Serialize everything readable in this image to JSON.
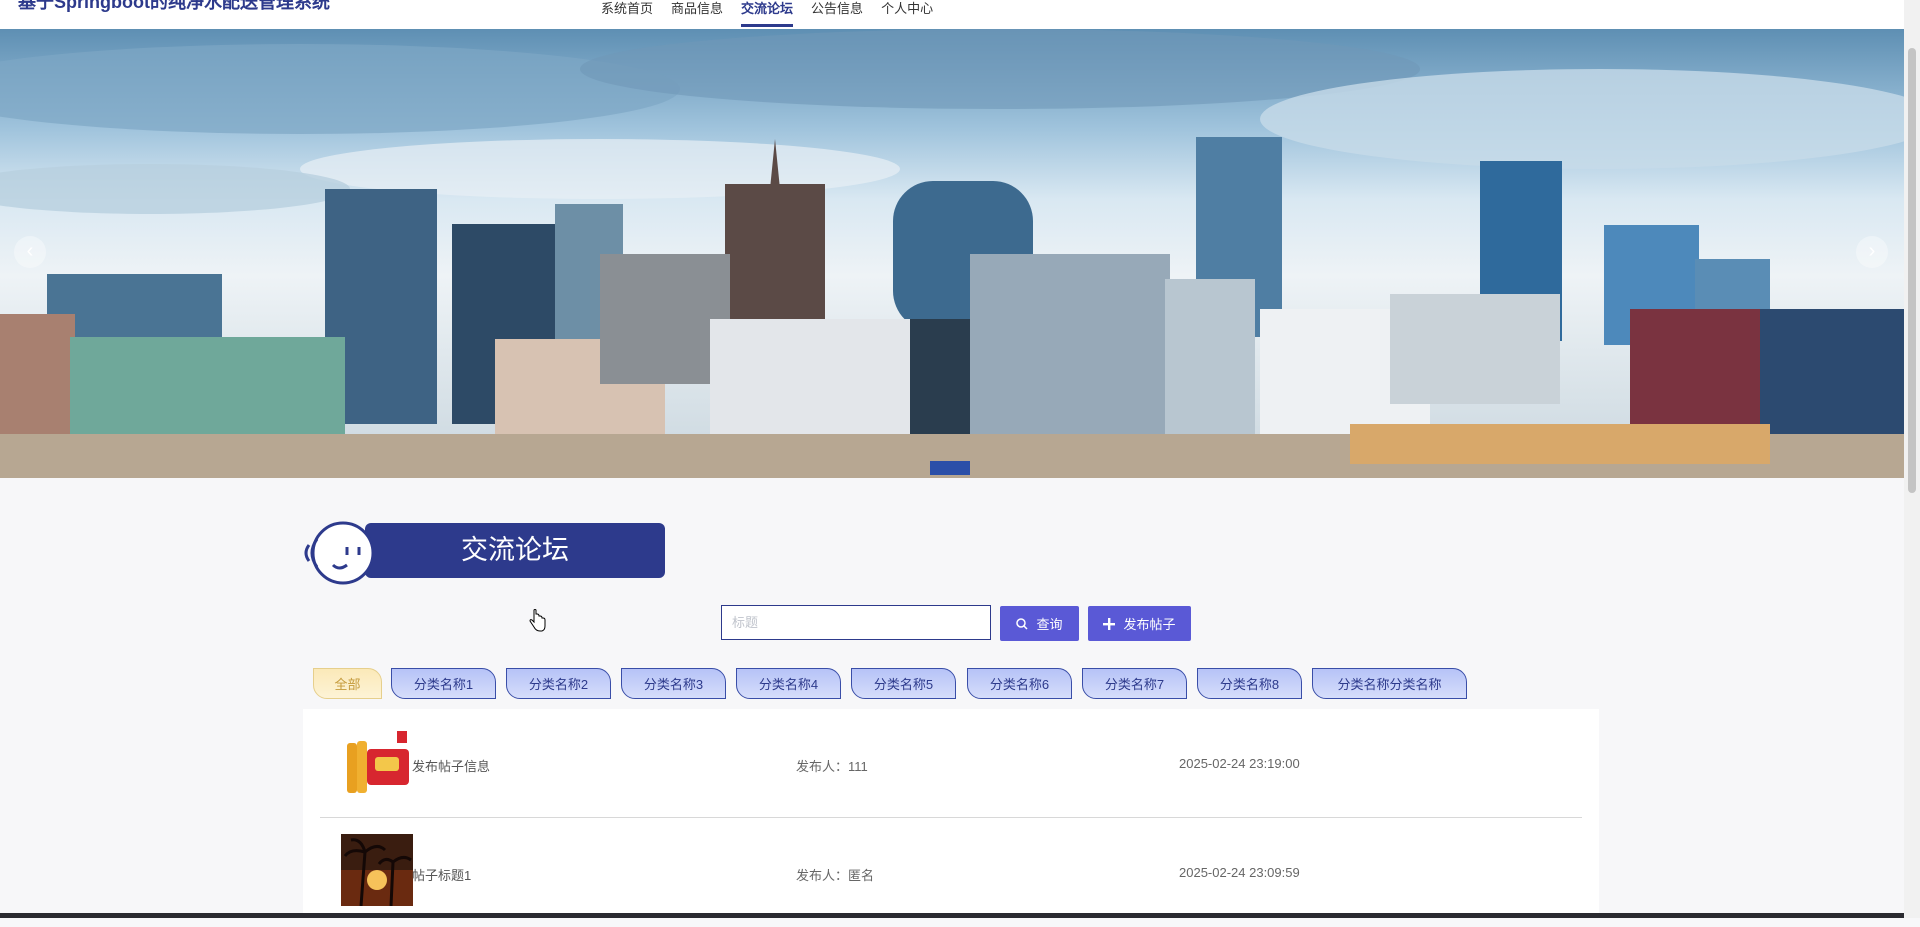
{
  "header": {
    "site_title": "基于Springboot的纯净水配送管理系统",
    "nav": [
      {
        "label": "系统首页",
        "active": false
      },
      {
        "label": "商品信息",
        "active": false
      },
      {
        "label": "交流论坛",
        "active": true
      },
      {
        "label": "公告信息",
        "active": false
      },
      {
        "label": "个人中心",
        "active": false
      }
    ]
  },
  "banner": {
    "prev_icon": "chevron-left-icon",
    "next_icon": "chevron-right-icon",
    "prev_glyph": "‹",
    "next_glyph": "›"
  },
  "section": {
    "title": "交流论坛"
  },
  "search": {
    "placeholder": "标题",
    "query_label": "查询",
    "publish_label": "发布帖子",
    "query_icon": "search-icon",
    "publish_icon": "plus-icon"
  },
  "categories": [
    {
      "label": "全部",
      "selected": true
    },
    {
      "label": "分类名称1",
      "selected": false
    },
    {
      "label": "分类名称2",
      "selected": false
    },
    {
      "label": "分类名称3",
      "selected": false
    },
    {
      "label": "分类名称4",
      "selected": false
    },
    {
      "label": "分类名称5",
      "selected": false
    },
    {
      "label": "分类名称6",
      "selected": false
    },
    {
      "label": "分类名称7",
      "selected": false
    },
    {
      "label": "分类名称8",
      "selected": false
    },
    {
      "label": "分类名称分类名称",
      "selected": false
    }
  ],
  "posts": [
    {
      "title": "发布帖子信息",
      "author": "发布人：111",
      "date": "2025-02-24 23:19:00"
    },
    {
      "title": "帖子标题1",
      "author": "发布人：匿名",
      "date": "2025-02-24 23:09:59"
    }
  ],
  "colors": {
    "brand": "#2d3a8c",
    "button": "#5a59d6"
  }
}
